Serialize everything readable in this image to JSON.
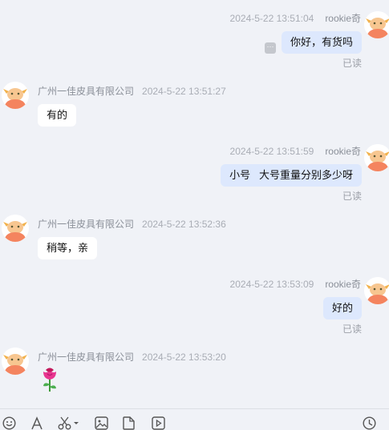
{
  "messages": [
    {
      "time": "2024-5-22 13:51:04",
      "sender": "rookie奇",
      "text": "你好，有货吗",
      "status": "已读"
    },
    {
      "time": "2024-5-22 13:51:27",
      "sender": "广州一佳皮具有限公司",
      "text": "有的"
    },
    {
      "time": "2024-5-22 13:51:59",
      "sender": "rookie奇",
      "text": "小号   大号重量分别多少呀",
      "status": "已读"
    },
    {
      "time": "2024-5-22 13:52:36",
      "sender": "广州一佳皮具有限公司",
      "text": "稍等，亲"
    },
    {
      "time": "2024-5-22 13:53:09",
      "sender": "rookie奇",
      "text": "好的",
      "status": "已读"
    },
    {
      "time": "2024-5-22 13:53:20",
      "sender": "广州一佳皮具有限公司",
      "text": "",
      "emoji": "rose-icon"
    }
  ],
  "more_button": "···",
  "toolbar": [
    "emoji-icon",
    "font-icon",
    "scissors-icon",
    "image-icon",
    "file-icon",
    "video-icon",
    "history-icon"
  ],
  "colors": {
    "background": "#f0f2f7",
    "my_bubble": "#dde8fd",
    "their_bubble": "#ffffff",
    "avatar_orange": "#f4845f",
    "rose_pink": "#e8368f"
  }
}
